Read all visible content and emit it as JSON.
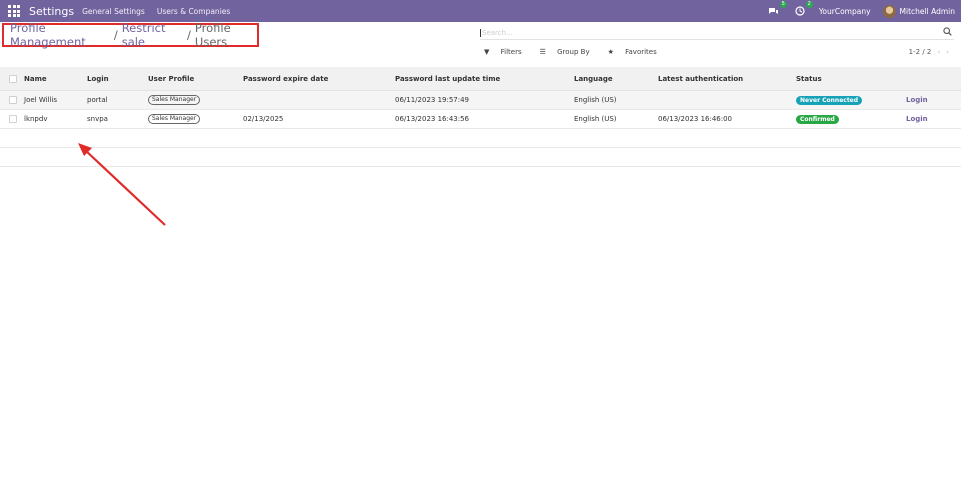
{
  "navbar": {
    "app_name": "Settings",
    "menu": [
      "General Settings",
      "Users & Companies"
    ],
    "messages_count": "5",
    "activity_count": "2",
    "company": "YourCompany",
    "user": "Mitchell Admin"
  },
  "breadcrumb": {
    "items": [
      "Profile Management",
      "Restrict sale"
    ],
    "current": "Profile Users",
    "separator": "/"
  },
  "search": {
    "placeholder": "Search...",
    "value": ""
  },
  "filters": {
    "filters_label": "Filters",
    "group_by_label": "Group By",
    "favorites_label": "Favorites"
  },
  "pager": {
    "text": "1-2 / 2"
  },
  "table": {
    "columns": [
      "Name",
      "Login",
      "User Profile",
      "Password expire date",
      "Password last update time",
      "Language",
      "Latest authentication",
      "Status"
    ],
    "rows": [
      {
        "name": "Joel Willis",
        "login": "portal",
        "profile": "Sales Manager",
        "password_expire": "",
        "password_update": "06/11/2023 19:57:49",
        "language": "English (US)",
        "latest_auth": "",
        "status": "Never Connected",
        "action": "Login"
      },
      {
        "name": "lknpdv",
        "login": "snvpa",
        "profile": "Sales Manager",
        "password_expire": "02/13/2025",
        "password_update": "06/13/2023 16:43:56",
        "language": "English (US)",
        "latest_auth": "06/13/2023 16:46:00",
        "status": "Confirmed",
        "action": "Login"
      }
    ]
  },
  "colors": {
    "navbar": "#71639e",
    "highlight_box": "#e02b2b",
    "annotation_arrow": "#e02b2b",
    "status_never_connected": "#17a2b8",
    "status_confirmed": "#28a745"
  }
}
